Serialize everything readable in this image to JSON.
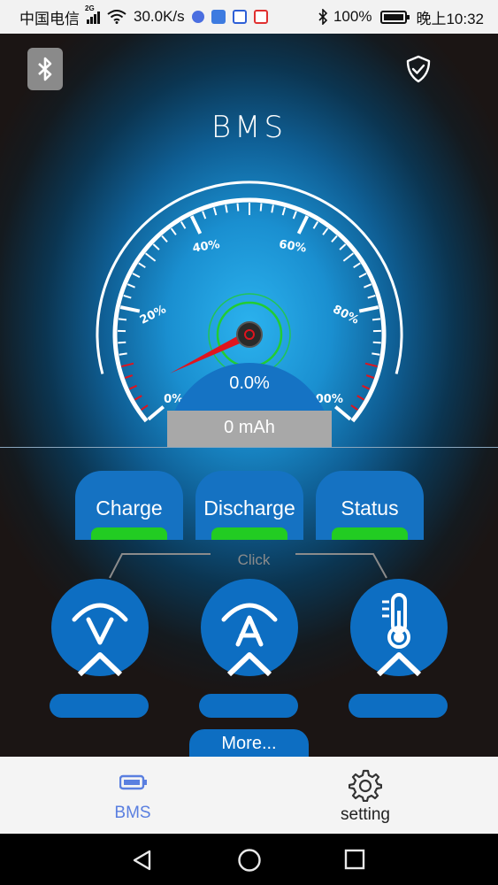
{
  "status_bar": {
    "carrier": "中国电信",
    "network_badge": "2G",
    "speed": "30.0K/s",
    "battery": "100%",
    "time": "晚上10:32"
  },
  "header": {
    "bluetooth_icon": "bluetooth-icon",
    "shield_icon": "shield-check-icon",
    "title": "BMS"
  },
  "gauge": {
    "tick_labels": [
      "0%",
      "20%",
      "40%",
      "60%",
      "80%",
      "100%"
    ],
    "value_percent": 0,
    "colors": {
      "needle": "#e0141e",
      "ring": "#22cc33",
      "arc": "#ffffff"
    }
  },
  "readout": {
    "percent": "0.0%",
    "capacity": "0 mAh"
  },
  "status_cards": [
    {
      "label": "Charge",
      "indicator_color": "#22cc22"
    },
    {
      "label": "Discharge",
      "indicator_color": "#22cc22"
    },
    {
      "label": "Status",
      "indicator_color": "#22cc22"
    }
  ],
  "click_hint": "Click",
  "sensor_buttons": [
    {
      "icon": "voltage-icon",
      "glyph": "V",
      "value": ""
    },
    {
      "icon": "current-icon",
      "glyph": "A",
      "value": ""
    },
    {
      "icon": "thermometer-icon",
      "glyph": "",
      "value": ""
    }
  ],
  "more_button": "More...",
  "bottom_nav": {
    "items": [
      {
        "label": "BMS",
        "icon": "battery-icon",
        "active": true
      },
      {
        "label": "setting",
        "icon": "gear-icon",
        "active": false
      }
    ],
    "active_color": "#5a7fe0"
  },
  "system_nav": {
    "icons": [
      "back-icon",
      "home-icon",
      "recents-icon"
    ]
  }
}
